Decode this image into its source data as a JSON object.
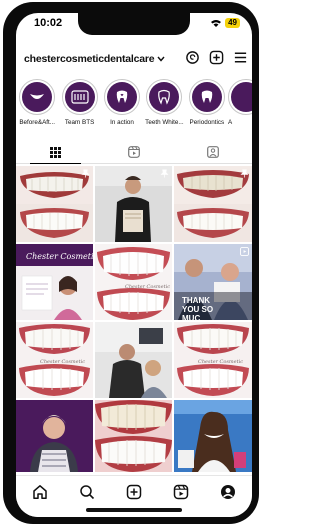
{
  "status_bar": {
    "time": "10:02",
    "battery": "49"
  },
  "profile": {
    "username": "chestercosmeticdentalcare"
  },
  "highlights": [
    {
      "label": "Before&Aft...",
      "icon": "smile-icon"
    },
    {
      "label": "Team BTS",
      "icon": "team-icon"
    },
    {
      "label": "In action",
      "icon": "tooth-heart-icon"
    },
    {
      "label": "Teeth White...",
      "icon": "tooth-icon"
    },
    {
      "label": "Periodontics",
      "icon": "tooth-icon"
    },
    {
      "label": "A",
      "icon": "tooth-icon"
    }
  ],
  "posts": {
    "thank_you_text": "THANK YOU SO MUC"
  },
  "colors": {
    "brand_purple": "#4a1a5c",
    "battery": "#f5d20a"
  }
}
